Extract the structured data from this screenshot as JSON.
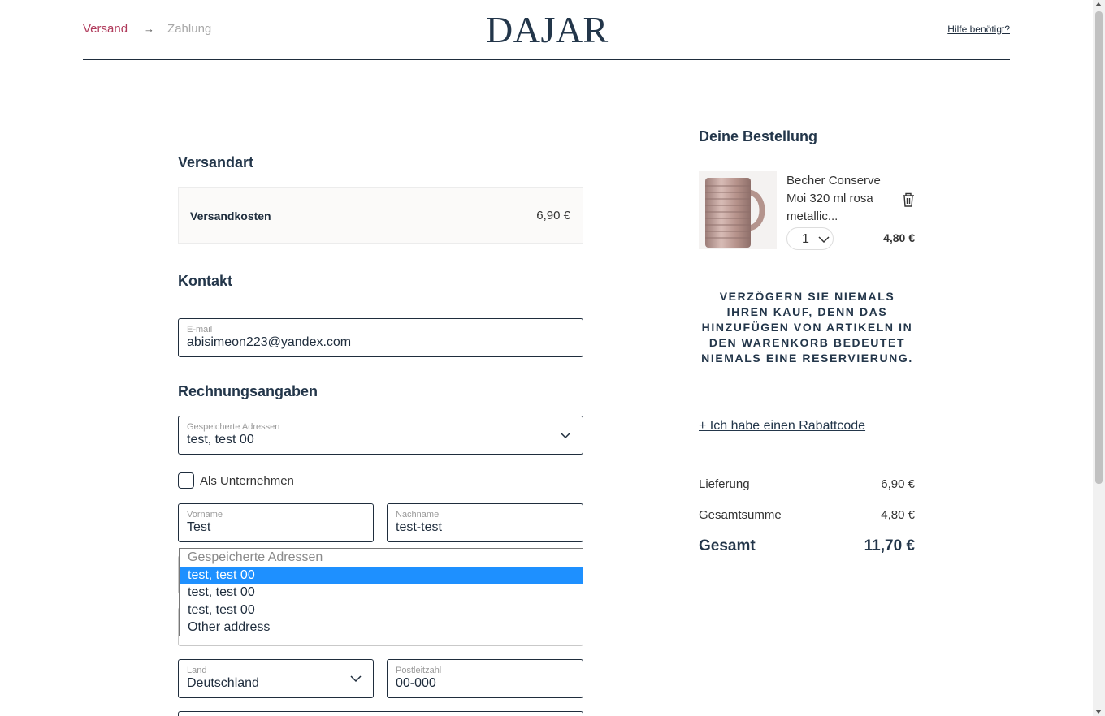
{
  "header": {
    "steps": [
      {
        "label": "Versand"
      },
      {
        "label": "Zahlung"
      }
    ],
    "logo": "DAJAR",
    "help": "Hilfe benötigt?"
  },
  "shipping": {
    "title": "Versandart",
    "option_label": "Versandkosten",
    "option_price": "6,90 €"
  },
  "contact": {
    "title": "Kontakt",
    "email_label": "E-mail",
    "email_value": "abisimeon223@yandex.com"
  },
  "billing": {
    "title": "Rechnungsangaben",
    "saved_label": "Gespeicherte Adressen",
    "saved_value": "test, test 00",
    "company_checkbox": "Als Unternehmen",
    "firstname_label": "Vorname",
    "firstname_value": "Test",
    "lastname_label": "Nachname",
    "lastname_value": "test-test",
    "country_label": "Land",
    "country_value": "Deutschland",
    "zip_label": "Postleitzahl",
    "zip_value": "00-000"
  },
  "dropdown": {
    "options": [
      {
        "label": "Gespeicherte Adressen",
        "state": "disabled"
      },
      {
        "label": "test, test 00",
        "state": "selected"
      },
      {
        "label": "test, test 00",
        "state": ""
      },
      {
        "label": "test, test 00",
        "state": ""
      },
      {
        "label": "Other address",
        "state": ""
      }
    ]
  },
  "order": {
    "title": "Deine Bestellung",
    "product_name": "Becher Conserve Moi 320 ml rosa metallic...",
    "quantity": "1",
    "line_price": "4,80 €",
    "notice": "VERZÖGERN SIE NIEMALS IHREN KAUF, DENN DAS HINZUFÜGEN VON ARTIKELN IN DEN WARENKORB BEDEUTET NIEMALS EINE RESERVIERUNG.",
    "discount_link": "+ Ich habe einen Rabattcode",
    "delivery_label": "Lieferung",
    "delivery_value": "6,90 €",
    "subtotal_label": "Gesamtsumme",
    "subtotal_value": "4,80 €",
    "total_label": "Gesamt",
    "total_value": "11,70 €"
  },
  "colors": {
    "accent": "#b03a5b",
    "navy": "#23364a",
    "selection": "#1e90ff"
  }
}
